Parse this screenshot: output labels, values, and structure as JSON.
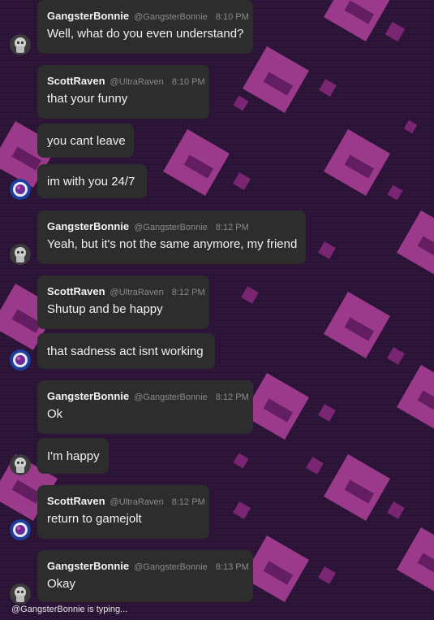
{
  "messages": [
    {
      "user": "GangsterBonnie",
      "handle": "@GangsterBonnie",
      "time": "8:10 PM",
      "lines": [
        "Well, what do you even understand?"
      ],
      "avatar": "bonnie-avatar"
    },
    {
      "user": "ScottRaven",
      "handle": "@UltraRaven",
      "time": "8:10 PM",
      "lines": [
        "that your funny",
        "you cant leave",
        "im with you 24/7"
      ],
      "avatar": "raven-avatar"
    },
    {
      "user": "GangsterBonnie",
      "handle": "@GangsterBonnie",
      "time": "8:12 PM",
      "lines": [
        "Yeah, but it's not the same anymore, my friend"
      ],
      "avatar": "bonnie-avatar"
    },
    {
      "user": "ScottRaven",
      "handle": "@UltraRaven",
      "time": "8:12 PM",
      "lines": [
        "Shutup and be happy",
        "that sadness act isnt working"
      ],
      "avatar": "raven-avatar"
    },
    {
      "user": "GangsterBonnie",
      "handle": "@GangsterBonnie",
      "time": "8:12 PM",
      "lines": [
        "Ok",
        "I'm happy"
      ],
      "avatar": "bonnie-avatar"
    },
    {
      "user": "ScottRaven",
      "handle": "@UltraRaven",
      "time": "8:12 PM",
      "lines": [
        "return to gamejolt"
      ],
      "avatar": "raven-avatar"
    },
    {
      "user": "GangsterBonnie",
      "handle": "@GangsterBonnie",
      "time": "8:13 PM",
      "lines": [
        "Okay"
      ],
      "avatar": "bonnie-avatar"
    }
  ],
  "typing_indicator": "@GangsterBonnie is typing...",
  "colors": {
    "bubble": "#2d2d2d",
    "accent_pink": "#b0409a",
    "background": "#2a1434"
  }
}
